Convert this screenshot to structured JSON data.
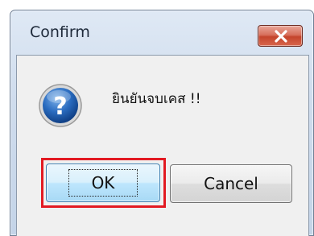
{
  "dialog": {
    "title": "Confirm",
    "message": "ยินยันจบเคส !!",
    "icon": "question-icon",
    "buttons": {
      "ok_label": "OK",
      "cancel_label": "Cancel"
    }
  },
  "colors": {
    "close_button": "#c4452c",
    "focus_highlight": "#e21a22",
    "dialog_background": "#f0f0f0",
    "title_bar": "#cfdced",
    "icon_blue": "#1f5fb0"
  }
}
